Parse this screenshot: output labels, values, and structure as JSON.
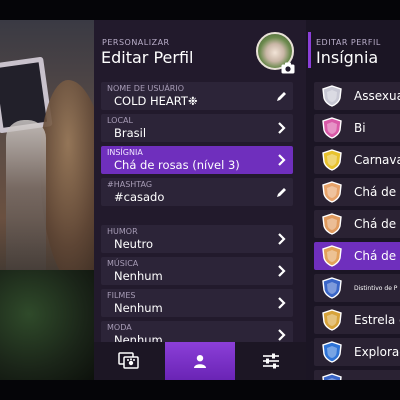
{
  "left_panel": {
    "kicker": "PERSONALIZAR",
    "title": "Editar Perfil",
    "fields": [
      {
        "label": "NOME DE USUÁRIO",
        "value": "COLD HEART❉",
        "action": "pencil-icon"
      },
      {
        "label": "LOCAL",
        "value": "Brasil",
        "action": "chevron-right-icon"
      },
      {
        "label": "INSÍGNIA",
        "value": "Chá de rosas (nível 3)",
        "action": "chevron-right-icon",
        "selected": true
      },
      {
        "label": "#HASHTAG",
        "value": "#casado",
        "action": "pencil-icon"
      },
      {
        "label": "HUMOR",
        "value": "Neutro",
        "action": "chevron-right-icon"
      },
      {
        "label": "MÚSICA",
        "value": "Nenhum",
        "action": "chevron-right-icon"
      },
      {
        "label": "FILMES",
        "value": "Nenhum",
        "action": "chevron-right-icon"
      },
      {
        "label": "MODA",
        "value": "Nenhum",
        "action": "chevron-right-icon"
      }
    ],
    "tabs": [
      {
        "icon": "pet-picture-icon",
        "active": false
      },
      {
        "icon": "profile-icon",
        "active": true
      },
      {
        "icon": "settings-sliders-icon",
        "active": false
      }
    ]
  },
  "right_panel": {
    "kicker": "EDITAR PERFIL",
    "title": "Insígnia",
    "badges": [
      {
        "name": "Assexua",
        "color": "#c8c8d4",
        "selected": false
      },
      {
        "name": "Bi",
        "color": "#d95aa8",
        "selected": false
      },
      {
        "name": "Carnava",
        "color": "#e8c22e",
        "selected": false
      },
      {
        "name": "Chá de r",
        "color": "#e7a36a",
        "selected": false
      },
      {
        "name": "Chá de r",
        "color": "#e09a5e",
        "selected": false
      },
      {
        "name": "Chá de r",
        "color": "#e3a25a",
        "selected": true
      },
      {
        "name": "Distintivo de P",
        "color": "#3a66c8",
        "selected": false
      },
      {
        "name": "Estrela d",
        "color": "#d7a33a",
        "selected": false
      },
      {
        "name": "Explorad",
        "color": "#2e73d6",
        "selected": false
      },
      {
        "name": "",
        "color": "#3a66c8",
        "selected": false
      }
    ]
  },
  "colors": {
    "accent": "#6f2fbd",
    "panel": "#221a2c",
    "field": "#2c2438"
  }
}
